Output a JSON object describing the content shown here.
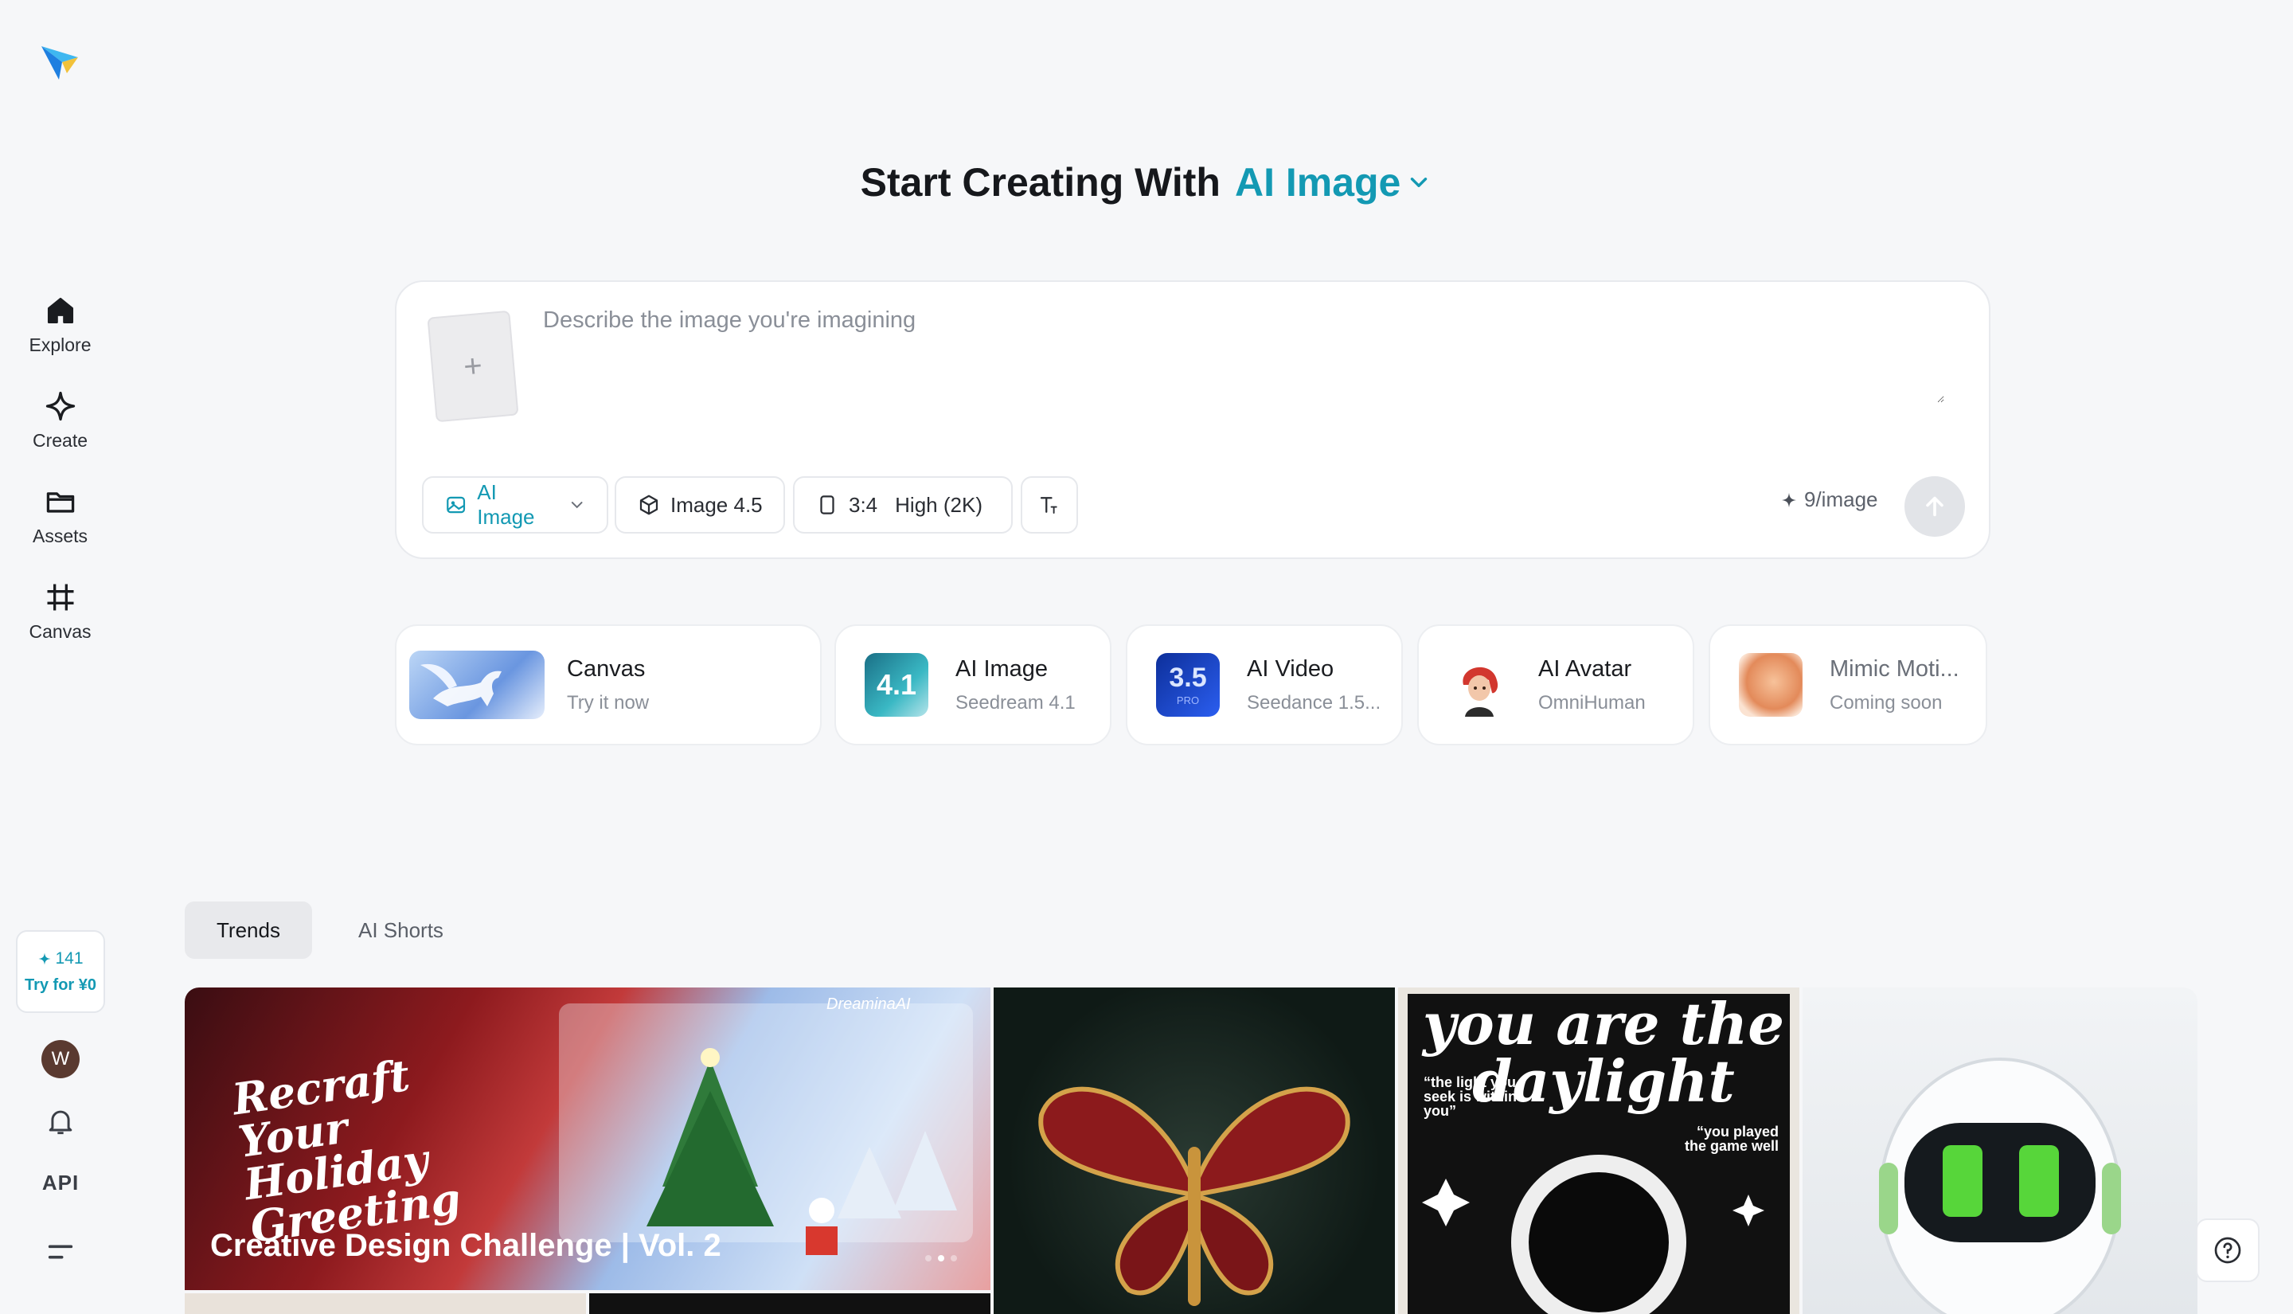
{
  "sidebar": {
    "logo_icon": "dreamina-logo-icon",
    "items": [
      {
        "label": "Explore",
        "icon": "home-icon"
      },
      {
        "label": "Create",
        "icon": "sparkle-icon"
      },
      {
        "label": "Assets",
        "icon": "folder-icon"
      },
      {
        "label": "Canvas",
        "icon": "crop-icon"
      }
    ],
    "credits": "141",
    "try_label": "Try for ¥0",
    "avatar_initial": "W",
    "api_label": "API"
  },
  "headline": {
    "prefix": "Start Creating With",
    "mode": "AI Image"
  },
  "prompt": {
    "placeholder": "Describe the image you're imagining",
    "value": "",
    "upload_symbol": "+",
    "chips": {
      "mode": "AI Image",
      "model": "Image 4.5",
      "ratio": "3:4",
      "quality": "High (2K)"
    },
    "cost": "9/image"
  },
  "tools": [
    {
      "title": "Canvas",
      "subtitle": "Try it now"
    },
    {
      "title": "AI Image",
      "subtitle": "Seedream 4.1",
      "badge": "4.1"
    },
    {
      "title": "AI Video",
      "subtitle": "Seedance 1.5...",
      "badge": "3.5",
      "badge_sub": "PRO"
    },
    {
      "title": "AI Avatar",
      "subtitle": "OmniHuman"
    },
    {
      "title": "Mimic Moti...",
      "subtitle": "Coming soon"
    }
  ],
  "tabs": [
    {
      "label": "Trends",
      "active": true
    },
    {
      "label": "AI Shorts",
      "active": false
    }
  ],
  "gallery": {
    "banner_script": "Recraft Your Holiday Greeting",
    "banner_brand": "DreaminaAI",
    "banner_caption": "Creative Design Challenge | Vol. 2",
    "poster_title": "you are the daylight",
    "poster_quote_left": "“the light you seek is within you”",
    "poster_quote_right": "“you played the game well"
  },
  "colors": {
    "accent": "#1399b3",
    "background": "#f6f7f9"
  }
}
